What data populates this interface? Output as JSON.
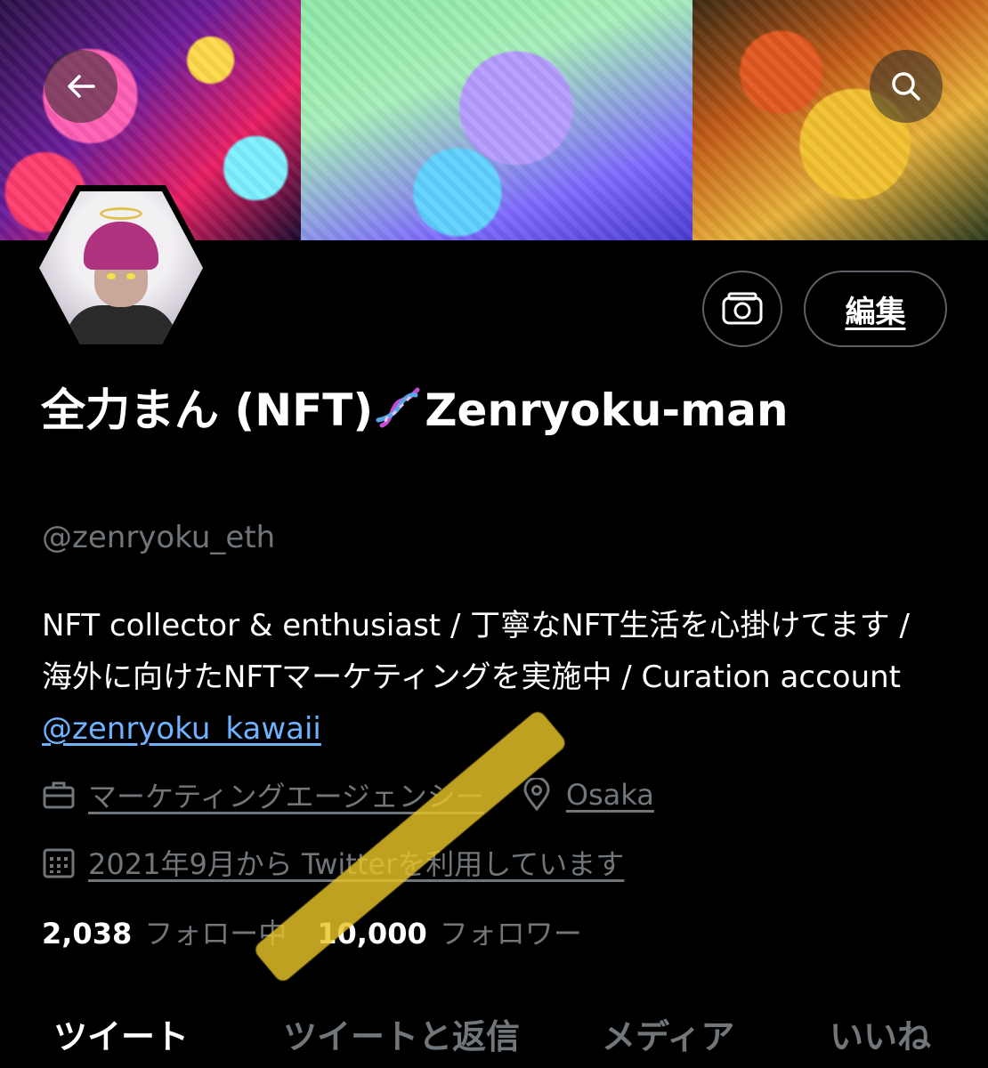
{
  "header": {
    "back_icon": "arrow-left-icon",
    "search_icon": "search-icon"
  },
  "profile": {
    "display_name_part1": "全力まん (NFT)",
    "display_name_part2": "Zenryoku-man",
    "name_emoji": "dna-icon",
    "handle": "@zenryoku_eth",
    "edit_label": "編集",
    "bio_text": "NFT collector & enthusiast / 丁寧なNFT生活を心掛けてます / 海外に向けたNFTマーケティングを実施中 / Curation account ",
    "bio_link": "@zenryoku_kawaii",
    "category": "マーケティングエージェンシー",
    "location": "Osaka",
    "joined": "2021年9月から Twitterを利用しています",
    "following_count": "2,038",
    "following_label": "フォロー中",
    "followers_count": "10,000",
    "followers_label": "フォロワー"
  },
  "tabs": [
    {
      "label": "ツイート",
      "active": true
    },
    {
      "label": "ツイートと返信",
      "active": false
    },
    {
      "label": "メディア",
      "active": false
    },
    {
      "label": "いいね",
      "active": false
    }
  ],
  "colors": {
    "background": "#000000",
    "text_primary": "#ffffff",
    "text_secondary": "#71767b",
    "link": "#6fb2ff",
    "highlight": "#e8c428"
  }
}
